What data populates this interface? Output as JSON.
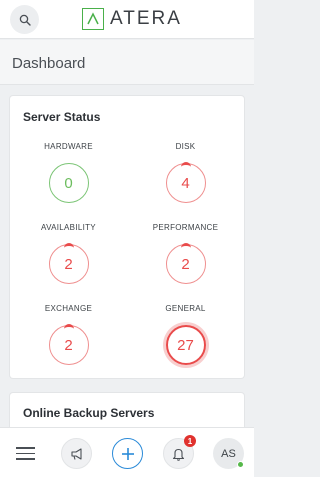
{
  "app": {
    "logo_text": "ATERA",
    "brand_color": "#4ab04a",
    "search_icon": "search-icon"
  },
  "page": {
    "title": "Dashboard"
  },
  "server_status": {
    "title": "Server Status",
    "stats": [
      {
        "label": "HARDWARE",
        "value": "0",
        "status": "ok"
      },
      {
        "label": "DISK",
        "value": "4",
        "status": "bad"
      },
      {
        "label": "AVAILABILITY",
        "value": "2",
        "status": "bad"
      },
      {
        "label": "PERFORMANCE",
        "value": "2",
        "status": "bad"
      },
      {
        "label": "EXCHANGE",
        "value": "2",
        "status": "bad"
      },
      {
        "label": "GENERAL",
        "value": "27",
        "status": "alert"
      }
    ],
    "colors": {
      "ok": "#6cbd5e",
      "bad": "#e94b4b"
    }
  },
  "online_backup": {
    "title": "Online Backup Servers"
  },
  "bottom_nav": {
    "menu_icon": "hamburger-icon",
    "announce_icon": "megaphone-icon",
    "add_icon": "plus-icon",
    "notifications_icon": "bell-icon",
    "notifications_count": "1",
    "avatar_initials": "AS",
    "accent_color": "#2a8ad8"
  }
}
